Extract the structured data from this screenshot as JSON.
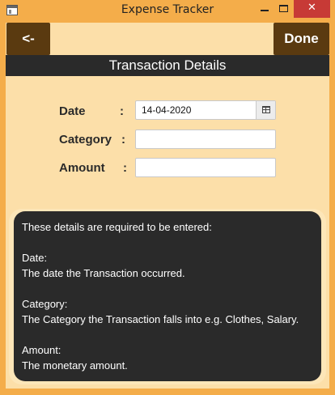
{
  "window": {
    "title": "Expense Tracker",
    "minimize_icon": "minimize-icon",
    "maximize_icon": "maximize-icon",
    "close_icon": "close-icon",
    "close_glyph": "✕"
  },
  "toolbar": {
    "back_label": "<-",
    "done_label": "Done"
  },
  "section": {
    "title": "Transaction Details"
  },
  "form": {
    "date": {
      "label": "Date",
      "colon": ":",
      "value": "14-04-2020"
    },
    "category": {
      "label": "Category",
      "colon": ":",
      "value": ""
    },
    "amount": {
      "label": "Amount",
      "colon": ":",
      "value": ""
    }
  },
  "info": {
    "lines": [
      "These details are required to be entered:",
      "",
      "Date:",
      "The date the Transaction occurred.",
      "",
      "Category:",
      "The Category the Transaction falls into e.g. Clothes, Salary.",
      "",
      "Amount:",
      "The monetary amount."
    ]
  },
  "colors": {
    "accent": "#5a3a10",
    "background": "#fcdfa9",
    "dark": "#2a2a2a",
    "window_frame": "#f4ad4a",
    "close_red": "#c73a36"
  }
}
